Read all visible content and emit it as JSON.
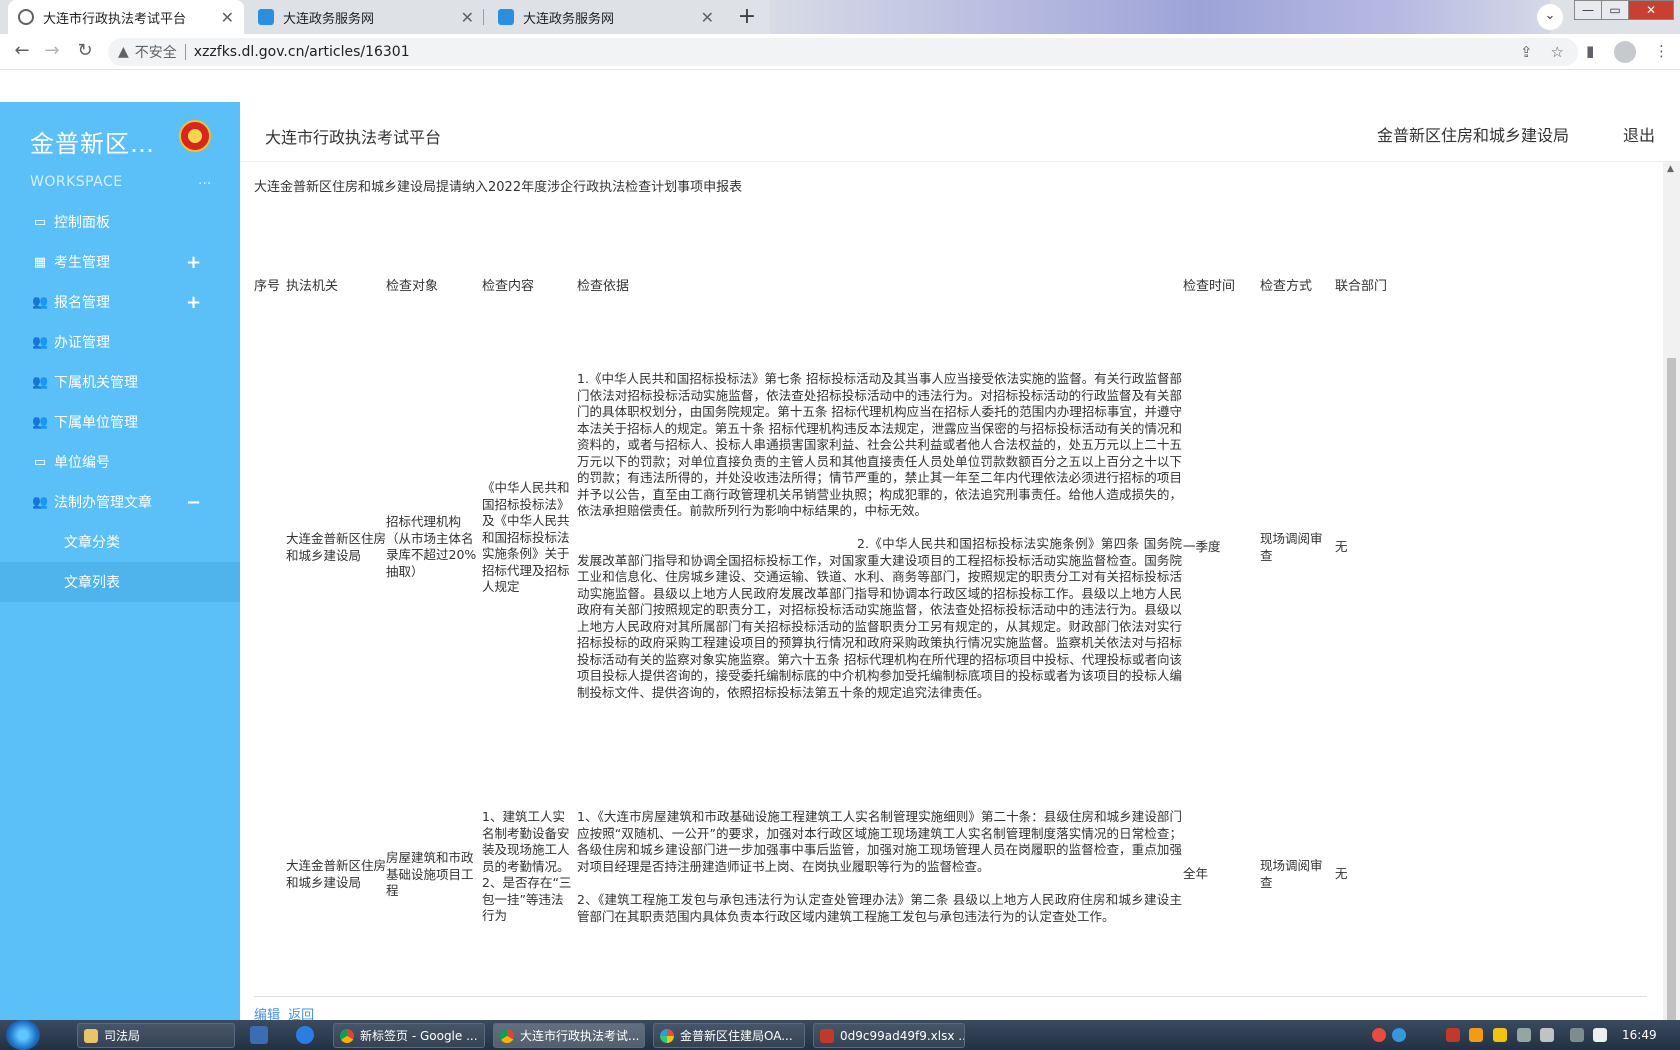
{
  "browser": {
    "tabs": [
      {
        "title": "大连市行政执法考试平台",
        "close": "✕",
        "icon": "globe-icon"
      },
      {
        "title": "大连政务服务网",
        "close": "✕",
        "icon": "gov-site-icon"
      },
      {
        "title": "大连政务服务网",
        "close": "✕",
        "icon": "gov-site-icon"
      }
    ],
    "new_tab": "+",
    "tab_dropdown": "⌄",
    "window_controls": {
      "minimize": "—",
      "maximize": "▭",
      "close": "✕"
    },
    "nav": {
      "back": "←",
      "forward": "→",
      "reload": "↻"
    },
    "address": {
      "warning_icon": "▲",
      "security_label": "不安全",
      "url": "xzzfks.dl.gov.cn/articles/16301"
    },
    "omnibox_icons": {
      "share": "⇪",
      "bookmark": "☆"
    },
    "toolbar_icons": {
      "side_panel": "▮",
      "menu": "⋮"
    }
  },
  "sidebar": {
    "logo": "金普新区…",
    "workspace": "WORKSPACE",
    "workspace_more": "...",
    "items": [
      {
        "label": "控制面板",
        "icon": "monitor-icon",
        "glyph": "▭",
        "toggle": ""
      },
      {
        "label": "考生管理",
        "icon": "grid-icon",
        "glyph": "▦",
        "toggle": "+"
      },
      {
        "label": "报名管理",
        "icon": "users-icon",
        "glyph": "👥",
        "toggle": "+"
      },
      {
        "label": "办证管理",
        "icon": "users-icon",
        "glyph": "👥",
        "toggle": ""
      },
      {
        "label": "下属机关管理",
        "icon": "users-icon",
        "glyph": "👥",
        "toggle": ""
      },
      {
        "label": "下属单位管理",
        "icon": "users-icon",
        "glyph": "👥",
        "toggle": ""
      },
      {
        "label": "单位编号",
        "icon": "monitor-icon",
        "glyph": "▭",
        "toggle": ""
      },
      {
        "label": "法制办管理文章",
        "icon": "users-icon",
        "glyph": "👥",
        "toggle": "−"
      }
    ],
    "subitems": [
      {
        "label": "文章分类"
      },
      {
        "label": "文章列表"
      }
    ]
  },
  "header": {
    "site_title": "大连市行政执法考试平台",
    "department": "金普新区住房和城乡建设局",
    "logout": "退出"
  },
  "article": {
    "title": "大连金普新区住房和城乡建设局提请纳入2022年度涉企行政执法检查计划事项申报表",
    "columns": [
      "序号",
      "执法机关",
      "检查对象",
      "检查内容",
      "检查依据",
      "检查时间",
      "检查方式",
      "联合部门"
    ],
    "rows": [
      {
        "agency": "大连金普新区住房和城乡建设局",
        "target": "招标代理机构（从市场主体名录库不超过20%抽取）",
        "content": "《中华人民共和国招标投标法》及《中华人民共和国招标投标法实施条例》关于招标代理及招标人规定",
        "basis_1": "1.《中华人民共和国招标投标法》第七条 招标投标活动及其当事人应当接受依法实施的监督。有关行政监督部门依法对招标投标活动实施监督，依法查处招标投标活动中的违法行为。对招标投标活动的行政监督及有关部门的具体职权划分，由国务院规定。第十五条 招标代理机构应当在招标人委托的范围内办理招标事宜，并遵守本法关于招标人的规定。第五十条 招标代理机构违反本法规定，泄露应当保密的与招标投标活动有关的情况和资料的，或者与招标人、投标人串通损害国家利益、社会公共利益或者他人合法权益的，处五万元以上二十五万元以下的罚款；对单位直接负责的主管人员和其他直接责任人员处单位罚款数额百分之五以上百分之十以下的罚款；有违法所得的，并处没收违法所得；情节严重的，禁止其一年至二年内代理依法必须进行招标的项目并予以公告，直至由工商行政管理机关吊销营业执照；构成犯罪的，依法追究刑事责任。给他人造成损失的，依法承担赔偿责任。前款所列行为影响中标结果的，中标无效。",
        "basis_2": "2.《中华人民共和国招标投标法实施条例》第四条 国务院发展改革部门指导和协调全国招标投标工作，对国家重大建设项目的工程招标投标活动实施监督检查。国务院工业和信息化、住房城乡建设、交通运输、铁道、水利、商务等部门，按照规定的职责分工对有关招标投标活动实施监督。县级以上地方人民政府发展改革部门指导和协调本行政区域的招标投标工作。县级以上地方人民政府有关部门按照规定的职责分工，对招标投标活动实施监督，依法查处招标投标活动中的违法行为。县级以上地方人民政府对其所属部门有关招标投标活动的监督职责分工另有规定的，从其规定。财政部门依法对实行招标投标的政府采购工程建设项目的预算执行情况和政府采购政策执行情况实施监督。监察机关依法对与招标投标活动有关的监察对象实施监察。第六十五条 招标代理机构在所代理的招标项目中投标、代理投标或者向该项目投标人提供咨询的，接受委托编制标底的中介机构参加受托编制标底项目的投标或者为该项目的投标人编制投标文件、提供咨询的，依照招标投标法第五十条的规定追究法律责任。",
        "time": "一季度",
        "method": "现场调阅审查",
        "joint": "无"
      },
      {
        "agency": "大连金普新区住房和城乡建设局",
        "target": "房屋建筑和市政基础设施项目工程",
        "content": "1、建筑工人实名制考勤设备安装及现场施工人员的考勤情况。\n2、是否存在“三包一挂”等违法行为",
        "basis_1": "1、《大连市房屋建筑和市政基础设施工程建筑工人实名制管理实施细则》第二十条：县级住房和城乡建设部门应按照“双随机、一公开”的要求，加强对本行政区域施工现场建筑工人实名制管理制度落实情况的日常检查；各级住房和城乡建设部门进一步加强事中事后监管，加强对施工现场管理人员在岗履职的监督检查，重点加强对项目经理是否持注册建造师证书上岗、在岗执业履职等行为的监督检查。",
        "basis_2": "2、《建筑工程施工发包与承包违法行为认定查处管理办法》第二条 县级以上地方人民政府住房和城乡建设主管部门在其职责范围内具体负责本行政区域内建筑工程施工发包与承包违法行为的认定查处工作。",
        "time": "全年",
        "method": "现场调阅审查",
        "joint": "无"
      }
    ],
    "actions": {
      "edit": "编辑",
      "back": "返回"
    }
  },
  "taskbar": {
    "items": [
      {
        "label": "司法局",
        "icon": "folder-icon"
      },
      {
        "label": "新标签页 - Google ...",
        "icon": "chrome-icon"
      },
      {
        "label": "大连市行政执法考试...",
        "icon": "chrome-icon"
      },
      {
        "label": "金普新区住建局OA...",
        "icon": "browser-icon"
      },
      {
        "label": "0d9c99ad49f9.xlsx ...",
        "icon": "wps-icon"
      }
    ],
    "clock": "16:49"
  }
}
